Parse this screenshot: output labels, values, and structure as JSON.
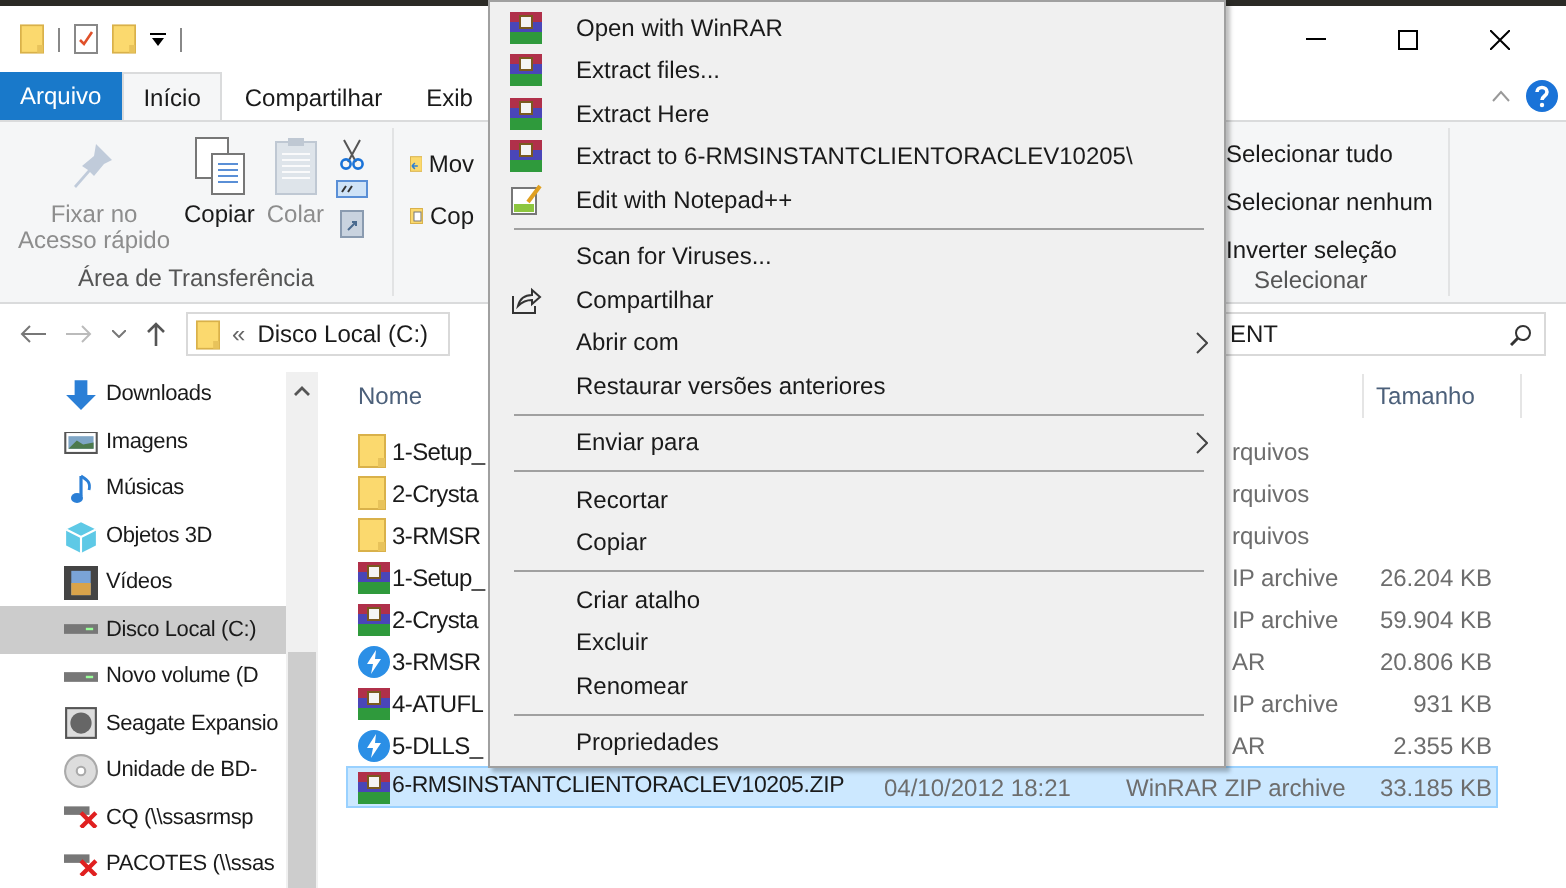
{
  "tabs": [
    {
      "label": "Arquivo",
      "kind": "file",
      "selected": false
    },
    {
      "label": "Início",
      "kind": "tab",
      "selected": true
    },
    {
      "label": "Compartilhar",
      "kind": "tab",
      "selected": false
    },
    {
      "label": "Exib",
      "kind": "tab",
      "selected": false
    }
  ],
  "clipboard": {
    "buttons": [
      {
        "label": "Fixar no Acesso rápido",
        "disabled": true
      },
      {
        "label": "Copiar",
        "disabled": false
      },
      {
        "label": "Colar",
        "disabled": true
      }
    ],
    "label": "Área de Transferência"
  },
  "organize": {
    "items": [
      "Mov",
      "Cop"
    ]
  },
  "select": {
    "items": [
      "Selecionar tudo",
      "Selecionar nenhum",
      "Inverter seleção"
    ],
    "label": "Selecionar"
  },
  "address": {
    "prefix": "«",
    "path": "Disco Local (C:)"
  },
  "search": {
    "value": "ENT"
  },
  "nav": [
    {
      "label": "Downloads",
      "kind": "download",
      "selected": false
    },
    {
      "label": "Imagens",
      "kind": "images",
      "selected": false
    },
    {
      "label": "Músicas",
      "kind": "music",
      "selected": false
    },
    {
      "label": "Objetos 3D",
      "kind": "objects",
      "selected": false
    },
    {
      "label": "Vídeos",
      "kind": "videos",
      "selected": false
    },
    {
      "label": "Disco Local (C:)",
      "kind": "drive",
      "selected": true
    },
    {
      "label": "Novo volume (D",
      "kind": "drive",
      "selected": false
    },
    {
      "label": "Seagate Expansio",
      "kind": "external",
      "selected": false
    },
    {
      "label": "Unidade de BD-",
      "kind": "optical",
      "selected": false
    },
    {
      "label": "CQ (\\\\ssasrmsp",
      "kind": "network",
      "selected": false
    },
    {
      "label": "PACOTES (\\\\ssas",
      "kind": "network",
      "selected": false
    }
  ],
  "columns": {
    "name": "Nome",
    "size": "Tamanho"
  },
  "files": [
    {
      "kind": "folder",
      "name": "1-Setup_",
      "type": "rquivos",
      "selected": false
    },
    {
      "kind": "folder",
      "name": "2-Crysta",
      "type": "rquivos",
      "selected": false
    },
    {
      "kind": "folder",
      "name": "3-RMSR",
      "type": "rquivos",
      "selected": false
    },
    {
      "kind": "archive",
      "name": "1-Setup_",
      "type": "IP archive",
      "size": "26.204 KB",
      "selected": false
    },
    {
      "kind": "archive",
      "name": "2-Crysta",
      "type": "IP archive",
      "size": "59.904 KB",
      "selected": false
    },
    {
      "kind": "installer",
      "name": "3-RMSR",
      "type": "AR",
      "size": "20.806 KB",
      "selected": false
    },
    {
      "kind": "archive",
      "name": "4-ATUFL",
      "type": "IP archive",
      "size": "931 KB",
      "selected": false
    },
    {
      "kind": "installer",
      "name": "5-DLLS_",
      "type": "AR",
      "size": "2.355 KB",
      "selected": false
    },
    {
      "kind": "archive",
      "name": "6-RMSINSTANTCLIENTORACLEV10205.ZIP",
      "date": "04/10/2012 18:21",
      "type": "WinRAR ZIP archive",
      "size": "33.185 KB",
      "selected": true
    }
  ],
  "menu": [
    [
      {
        "label": "Open with WinRAR",
        "kind": "archive"
      },
      {
        "label": "Extract files...",
        "kind": "archive"
      },
      {
        "label": "Extract Here",
        "kind": "archive"
      },
      {
        "label": "Extract to 6-RMSINSTANTCLIENTORACLEV10205\\",
        "kind": "archive"
      },
      {
        "label": "Edit with Notepad++",
        "kind": "notepad"
      }
    ],
    [
      {
        "label": "Scan for Viruses...",
        "kind": "plain"
      },
      {
        "label": "Compartilhar",
        "kind": "share"
      },
      {
        "label": "Abrir com",
        "kind": "plain",
        "submenu": true
      },
      {
        "label": "Restaurar versões anteriores",
        "kind": "plain"
      }
    ],
    [
      {
        "label": "Enviar para",
        "kind": "plain",
        "submenu": true
      }
    ],
    [
      {
        "label": "Recortar",
        "kind": "plain"
      },
      {
        "label": "Copiar",
        "kind": "plain"
      }
    ],
    [
      {
        "label": "Criar atalho",
        "kind": "plain"
      },
      {
        "label": "Excluir",
        "kind": "plain"
      },
      {
        "label": "Renomear",
        "kind": "plain"
      }
    ],
    [
      {
        "label": "Propriedades",
        "kind": "plain"
      }
    ]
  ]
}
